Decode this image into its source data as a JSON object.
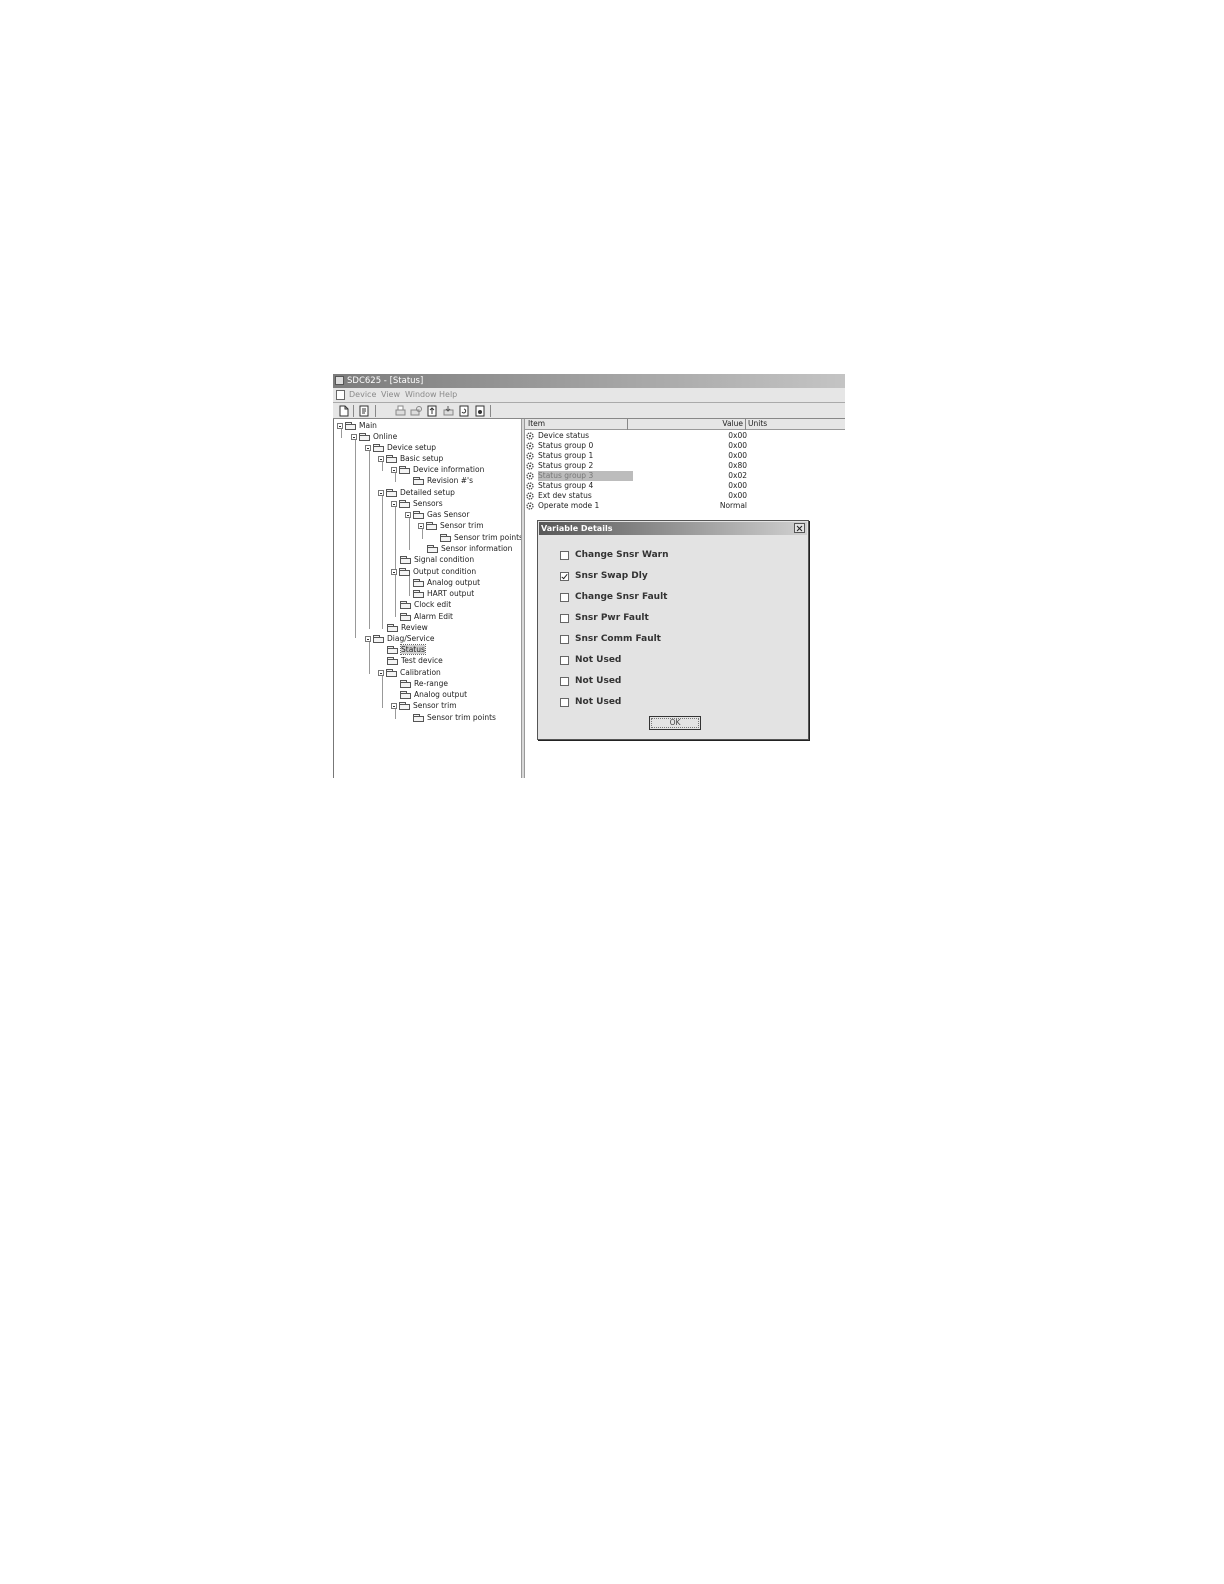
{
  "window": {
    "title": "SDC625 - [Status]"
  },
  "menu": [
    "Device",
    "View",
    "Window",
    "Help"
  ],
  "tree": [
    {
      "label": "Main"
    },
    {
      "label": "Online"
    },
    {
      "label": "Device setup"
    },
    {
      "label": "Basic setup"
    },
    {
      "label": "Device information"
    },
    {
      "label": "Revision #'s"
    },
    {
      "label": "Detailed setup"
    },
    {
      "label": "Sensors"
    },
    {
      "label": "Gas Sensor"
    },
    {
      "label": "Sensor trim"
    },
    {
      "label": "Sensor trim points"
    },
    {
      "label": "Sensor information"
    },
    {
      "label": "Signal condition"
    },
    {
      "label": "Output condition"
    },
    {
      "label": "Analog output"
    },
    {
      "label": "HART output"
    },
    {
      "label": "Clock edit"
    },
    {
      "label": "Alarm Edit"
    },
    {
      "label": "Review"
    },
    {
      "label": "Diag/Service"
    },
    {
      "label": "Status",
      "selected": true
    },
    {
      "label": "Test device"
    },
    {
      "label": "Calibration"
    },
    {
      "label": "Re-range"
    },
    {
      "label": "Analog output"
    },
    {
      "label": "Sensor trim"
    },
    {
      "label": "Sensor trim points"
    }
  ],
  "list": {
    "headers": {
      "item": "Item",
      "value": "Value",
      "units": "Units"
    },
    "rows": [
      {
        "item": "Device status",
        "value": "0x00"
      },
      {
        "item": "Status group 0",
        "value": "0x00"
      },
      {
        "item": "Status group 1",
        "value": "0x00"
      },
      {
        "item": "Status group 2",
        "value": "0x80"
      },
      {
        "item": "Status group 3",
        "value": "0x02",
        "highlighted": true
      },
      {
        "item": "Status group 4",
        "value": "0x00"
      },
      {
        "item": "Ext dev status",
        "value": "0x00"
      },
      {
        "item": "Operate mode 1",
        "value": "Normal"
      }
    ]
  },
  "dialog": {
    "title": "Variable Details",
    "options": [
      {
        "label": "Change Snsr Warn",
        "checked": false
      },
      {
        "label": "Snsr Swap Dly",
        "checked": true
      },
      {
        "label": "Change Snsr Fault",
        "checked": false
      },
      {
        "label": "Snsr Pwr Fault",
        "checked": false
      },
      {
        "label": "Snsr Comm Fault",
        "checked": false
      },
      {
        "label": "Not Used",
        "checked": false
      },
      {
        "label": "Not Used",
        "checked": false
      },
      {
        "label": "Not Used",
        "checked": false
      }
    ],
    "ok_label": "OK"
  },
  "icons": {
    "toolbar": [
      "new-document-icon",
      "device-icon",
      "print-icon",
      "print-preview-icon",
      "upload-icon",
      "download-icon",
      "refresh-icon",
      "info-icon"
    ],
    "tree": "folder-icon",
    "list": "variable-gear-icon"
  }
}
